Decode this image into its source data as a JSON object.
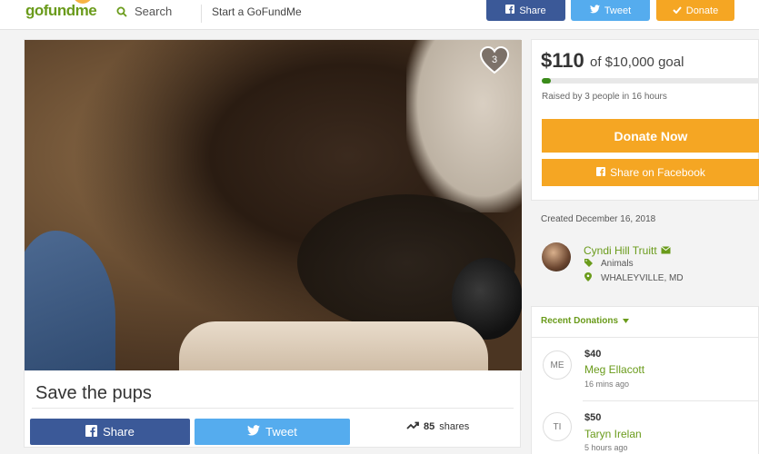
{
  "header": {
    "logo": "gofundme",
    "search_label": "Search",
    "start_label": "Start a GoFundMe",
    "share_label": "Share",
    "tweet_label": "Tweet",
    "donate_label": "Donate"
  },
  "campaign": {
    "heart_count": "3",
    "title": "Save the pups",
    "share_label": "Share",
    "tweet_label": "Tweet",
    "shares_count": "85",
    "shares_word": "shares"
  },
  "goal": {
    "raised": "$110",
    "goal_text": "of $10,000 goal",
    "progress_fraction": 0.011,
    "raised_by": "Raised by 3 people in 16 hours",
    "donate_now": "Donate Now",
    "share_facebook": "Share on Facebook"
  },
  "organizer": {
    "created": "Created December 16, 2018",
    "name": "Cyndi Hill Truitt",
    "category": "Animals",
    "location": "WHALEYVILLE, MD"
  },
  "recent": {
    "title": "Recent Donations",
    "donations": [
      {
        "initials": "ME",
        "amount": "$40",
        "name": "Meg Ellacott",
        "time": "16 mins ago"
      },
      {
        "initials": "TI",
        "amount": "$50",
        "name": "Taryn Irelan",
        "time": "5 hours ago"
      }
    ]
  },
  "colors": {
    "brand_green": "#6a9b1b",
    "facebook_blue": "#3b5998",
    "twitter_blue": "#55acee",
    "donate_orange": "#f5a623"
  },
  "icons": [
    "search-icon",
    "facebook-icon",
    "twitter-icon",
    "check-icon",
    "heart-icon",
    "trending-icon",
    "email-icon",
    "tag-icon",
    "location-pin-icon",
    "caret-down-icon"
  ]
}
